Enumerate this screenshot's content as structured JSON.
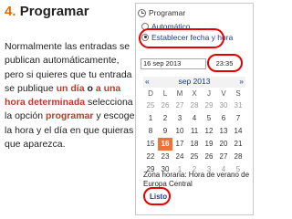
{
  "slide": {
    "number": "4.",
    "title": "Programar",
    "body": [
      {
        "t": "Normalmente las entradas se publican automáticamente, pero si quieres que tu entrada se publique ",
        "s": ""
      },
      {
        "t": "un día",
        "s": "hl"
      },
      {
        "t": " o ",
        "s": "b"
      },
      {
        "t": "a una hora determinada",
        "s": "hl"
      },
      {
        "t": " selecciona la opción ",
        "s": ""
      },
      {
        "t": "programar",
        "s": "hl"
      },
      {
        "t": " y escoge la hora y el día en que quieras que aparezca.",
        "s": ""
      }
    ]
  },
  "widget": {
    "icon": "clock-icon",
    "header_label": "Programar",
    "options": [
      {
        "label": "Automático",
        "checked": false
      },
      {
        "label": "Establecer fecha y hora",
        "checked": true
      }
    ],
    "date_value": "16 sep 2013",
    "time_value": "23:35",
    "calendar": {
      "prev": "«",
      "next": "»",
      "month_label": "sep 2013",
      "weekdays": [
        "D",
        "L",
        "M",
        "X",
        "J",
        "V",
        "S"
      ],
      "weeks": [
        [
          "25",
          "26",
          "27",
          "28",
          "29",
          "30",
          "31"
        ],
        [
          "1",
          "2",
          "3",
          "4",
          "5",
          "6",
          "7"
        ],
        [
          "8",
          "9",
          "10",
          "11",
          "12",
          "13",
          "14"
        ],
        [
          "15",
          "16",
          "17",
          "18",
          "19",
          "20",
          "21"
        ],
        [
          "22",
          "23",
          "24",
          "25",
          "26",
          "27",
          "28"
        ],
        [
          "29",
          "30",
          "1",
          "2",
          "3",
          "4",
          "5"
        ]
      ],
      "selected": "16",
      "accent_color": "#f07238"
    },
    "timezone_text": "Zona horaria: Hora de verano de Europa Central",
    "done_label": "Listo",
    "highlight_color": "#e60000"
  }
}
